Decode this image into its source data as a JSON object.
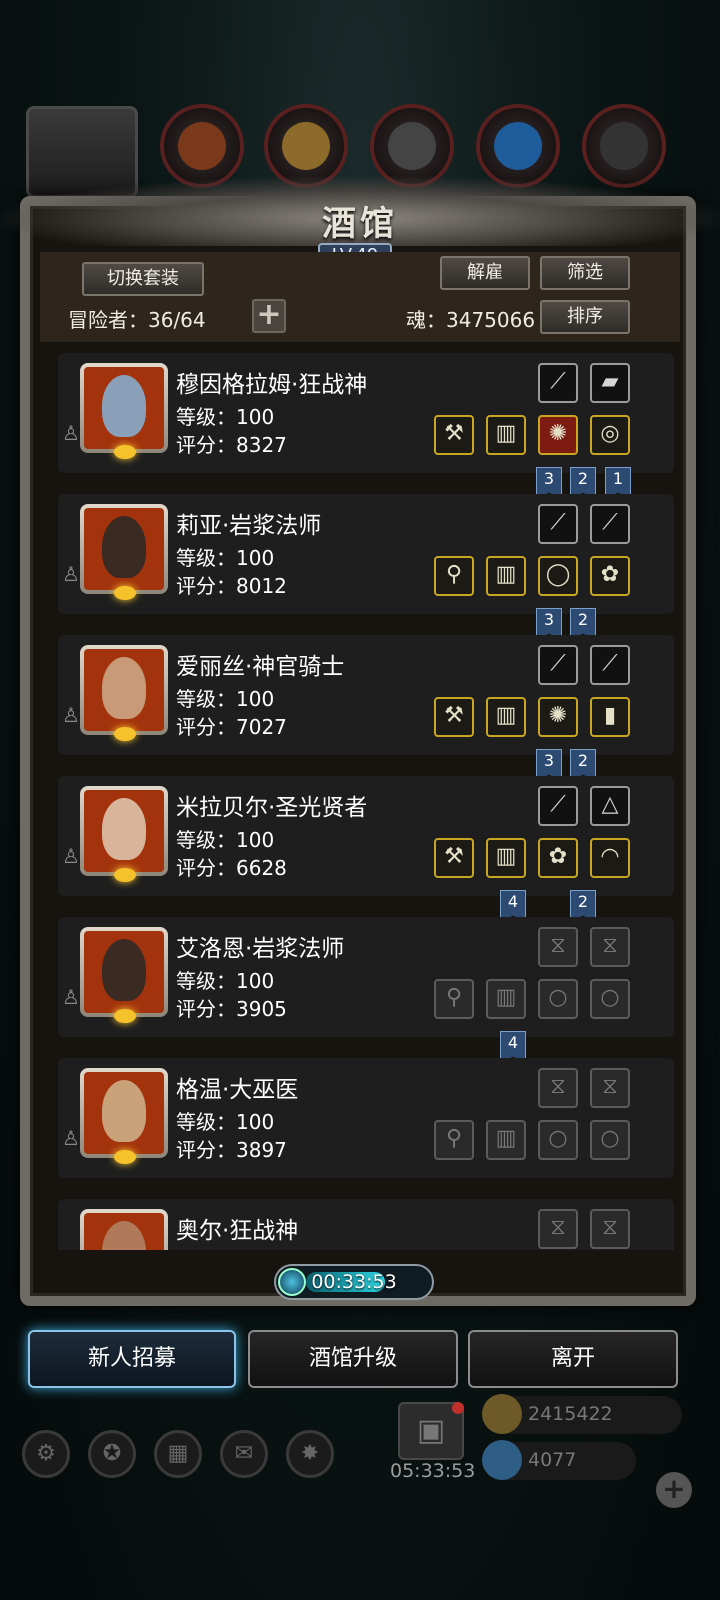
{
  "header": {
    "title": "酒馆",
    "level": "LV.49",
    "switch_outfit": "切换套装",
    "dismiss": "解雇",
    "filter": "筛选",
    "sort": "排序",
    "adventurers_label": "冒险者：36/64",
    "soul_label": "魂：3475066",
    "add_icon": "plus-icon"
  },
  "heroes": [
    {
      "name": "穆因格拉姆·狂战神",
      "level": "等级：100",
      "score": "评分：8327",
      "top_slots": [
        "⟋",
        "▰"
      ],
      "gear": [
        "⚒",
        "▥",
        "✺",
        "◎"
      ],
      "gear_red": [
        false,
        false,
        true,
        false
      ],
      "ribbons": [
        [
          "3",
          536
        ],
        [
          "2",
          570
        ],
        [
          "1",
          605
        ]
      ]
    },
    {
      "name": "莉亚·岩浆法师",
      "level": "等级：100",
      "score": "评分：8012",
      "top_slots": [
        "⟋",
        "⟋"
      ],
      "gear": [
        "⚲",
        "▥",
        "◯",
        "✿"
      ],
      "gear_red": [
        false,
        false,
        false,
        false
      ],
      "ribbons": [
        [
          "3",
          536
        ],
        [
          "2",
          570
        ]
      ]
    },
    {
      "name": "爱丽丝·神官骑士",
      "level": "等级：100",
      "score": "评分：7027",
      "top_slots": [
        "⟋",
        "⟋"
      ],
      "gear": [
        "⚒",
        "▥",
        "✺",
        "▮"
      ],
      "gear_red": [
        false,
        false,
        false,
        false
      ],
      "ribbons": [
        [
          "3",
          536
        ],
        [
          "2",
          570
        ]
      ]
    },
    {
      "name": "米拉贝尔·圣光贤者",
      "level": "等级：100",
      "score": "评分：6628",
      "top_slots": [
        "⟋",
        "△"
      ],
      "gear": [
        "⚒",
        "▥",
        "✿",
        "◠"
      ],
      "gear_red": [
        false,
        false,
        false,
        false
      ],
      "ribbons": [
        [
          "4",
          500
        ],
        [
          "2",
          570
        ]
      ]
    },
    {
      "name": "艾洛恩·岩浆法师",
      "level": "等级：100",
      "score": "评分：3905",
      "empty": true,
      "top_slots": [
        "⧖",
        "⧖"
      ],
      "gear": [
        "⚲",
        "▥",
        "○",
        "○"
      ],
      "ribbons": [
        [
          "4",
          500
        ]
      ]
    },
    {
      "name": "格温·大巫医",
      "level": "等级：100",
      "score": "评分：3897",
      "empty": true,
      "top_slots": [
        "⧖",
        "⧖"
      ],
      "gear": [
        "⚲",
        "▥",
        "○",
        "○"
      ],
      "ribbons": []
    },
    {
      "name": "奥尔·狂战神",
      "level": "",
      "score": "",
      "empty": true,
      "top_slots": [
        "⧖",
        "⧖"
      ],
      "gear": [],
      "ribbons": []
    }
  ],
  "timer": {
    "value": "00:33:53",
    "fill_fraction": 0.62
  },
  "buttons": {
    "recruit": "新人招募",
    "upgrade": "酒馆升级",
    "leave": "离开"
  },
  "dock": {
    "gift_timer": "05:33:53",
    "gold": "2415422",
    "gems": "4077"
  },
  "colors": {
    "panel_bg": "#17130f",
    "card_bg": "#1e1e1e",
    "gear_border": "#c8a622",
    "ribbon": "#2d4b72",
    "timer_fill": "#2dd6e4"
  }
}
